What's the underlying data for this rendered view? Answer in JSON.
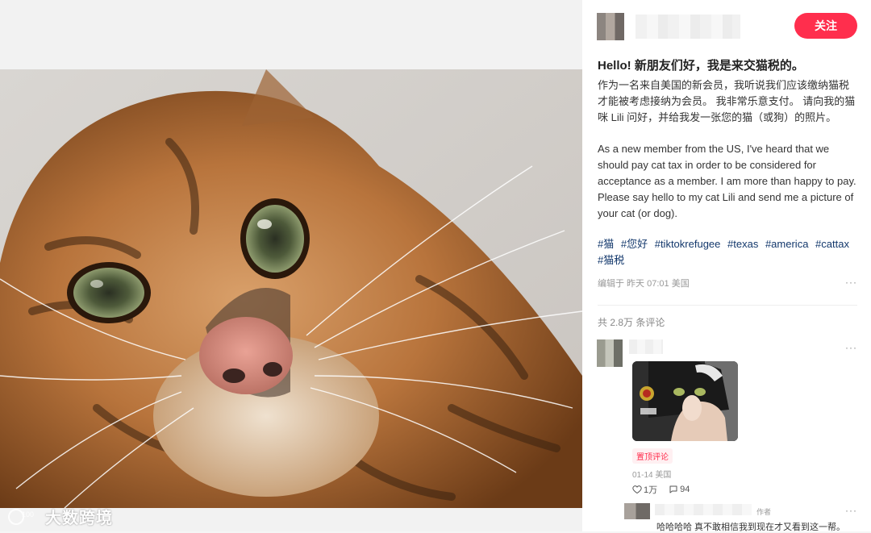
{
  "follow_label": "关注",
  "note": {
    "title": "Hello! 新朋友们好，我是来交猫税的。",
    "body_zh": "作为一名来自美国的新会员，我听说我们应该缴纳猫税才能被考虑接纳为会员。 我非常乐意支付。 请向我的猫咪 Lili 问好，并给我发一张您的猫（或狗）的照片。",
    "body_en": "As a new member from the US, I've heard that we should pay cat tax in order to be considered for acceptance as a member. I am more than happy to pay. Please say hello to my cat Lili and send me a picture of your cat (or dog).",
    "tags": [
      "#猫",
      "#您好",
      "#tiktokrefugee",
      "#texas",
      "#america",
      "#cattax",
      "#猫税"
    ],
    "meta": "编辑于 昨天 07:01 美国",
    "more": "···"
  },
  "comments": {
    "count_label": "共 2.8万 条评论",
    "top": {
      "pin_label": "置顶评论",
      "meta": "01-14 美国",
      "likes": "1万",
      "replies": "94",
      "more": "···"
    },
    "reply": {
      "badge": "作者",
      "text": "哈哈哈哈 真不敢相信我到现在才又看到这一帮。",
      "more": "···"
    }
  },
  "watermark": {
    "text": "大数跨境"
  },
  "icons": [
    "heart-icon",
    "comment-icon",
    "more-icon"
  ],
  "colors": {
    "accent": "#ff2e4d",
    "tag": "#13386c"
  }
}
